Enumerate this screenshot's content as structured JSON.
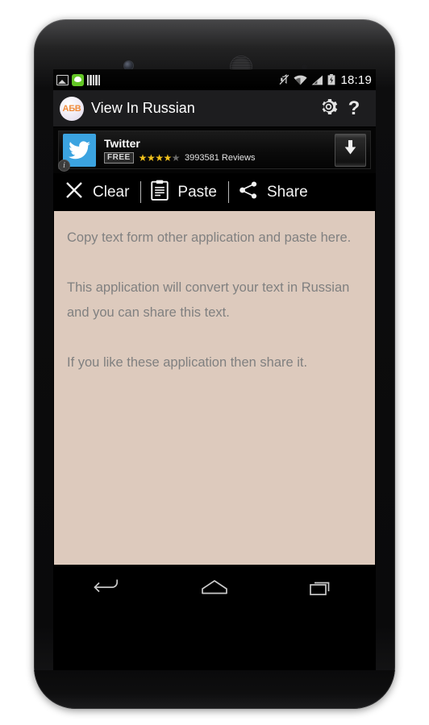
{
  "device": {
    "name": "android-phone"
  },
  "status_bar": {
    "time": "18:19",
    "left_icons": [
      "gallery-icon",
      "line-chat-icon",
      "barcode-icon"
    ],
    "right_icons": [
      "mute-icon",
      "wifi-icon",
      "signal-icon",
      "battery-charging-icon"
    ]
  },
  "app_bar": {
    "logo_text": "АБВ",
    "title": "View In Russian",
    "settings_icon": "gear-icon",
    "help_icon": "question-mark-icon"
  },
  "ad": {
    "app_icon": "twitter-bird-icon",
    "info_badge": "i",
    "title": "Twitter",
    "price": "FREE",
    "rating": 4,
    "rating_max": 5,
    "reviews": "3993581 Reviews",
    "download_icon": "download-arrow-icon"
  },
  "toolbar": {
    "clear_icon": "close-x-icon",
    "clear_label": "Clear",
    "paste_icon": "clipboard-icon",
    "paste_label": "Paste",
    "share_icon": "share-icon",
    "share_label": "Share"
  },
  "text_area": {
    "background": "#ddcabd",
    "text_color": "#808080",
    "paragraphs": [
      "Copy text form other application and paste here.",
      "This application will convert your text in Russian and you can share this text.",
      "If you like these application then share it."
    ]
  },
  "nav_bar": {
    "back_icon": "back-arrow-icon",
    "home_icon": "home-icon",
    "recents_icon": "recent-apps-icon"
  }
}
